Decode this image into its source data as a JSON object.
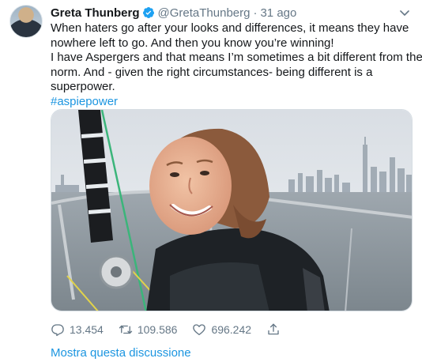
{
  "tweet": {
    "author_name": "Greta Thunberg",
    "author_handle": "@GretaThunberg",
    "separator": "·",
    "timestamp": "31 ago",
    "text_lines": [
      "When haters go after your looks and differences, it means they have",
      "nowhere left to go. And then you know you’re winning!",
      "I have Aspergers and that means I’m sometimes a bit different from the",
      "norm. And - given the right circumstances- being different is a",
      "superpower."
    ],
    "hashtag": "#aspiepower",
    "media_icon": "photo-greta-on-sailboat"
  },
  "actions": {
    "replies": "13.454",
    "retweets": "109.586",
    "likes": "696.242"
  },
  "icons": {
    "verified": "verified-badge-icon",
    "more": "chevron-down-icon",
    "reply": "reply-icon",
    "retweet": "retweet-icon",
    "like": "heart-icon",
    "share": "share-icon"
  },
  "footer": {
    "thread_link": "Mostra questa discussione"
  },
  "colors": {
    "link": "#1b95e0",
    "secondary_text": "#657786",
    "verified": "#1da1f2"
  }
}
